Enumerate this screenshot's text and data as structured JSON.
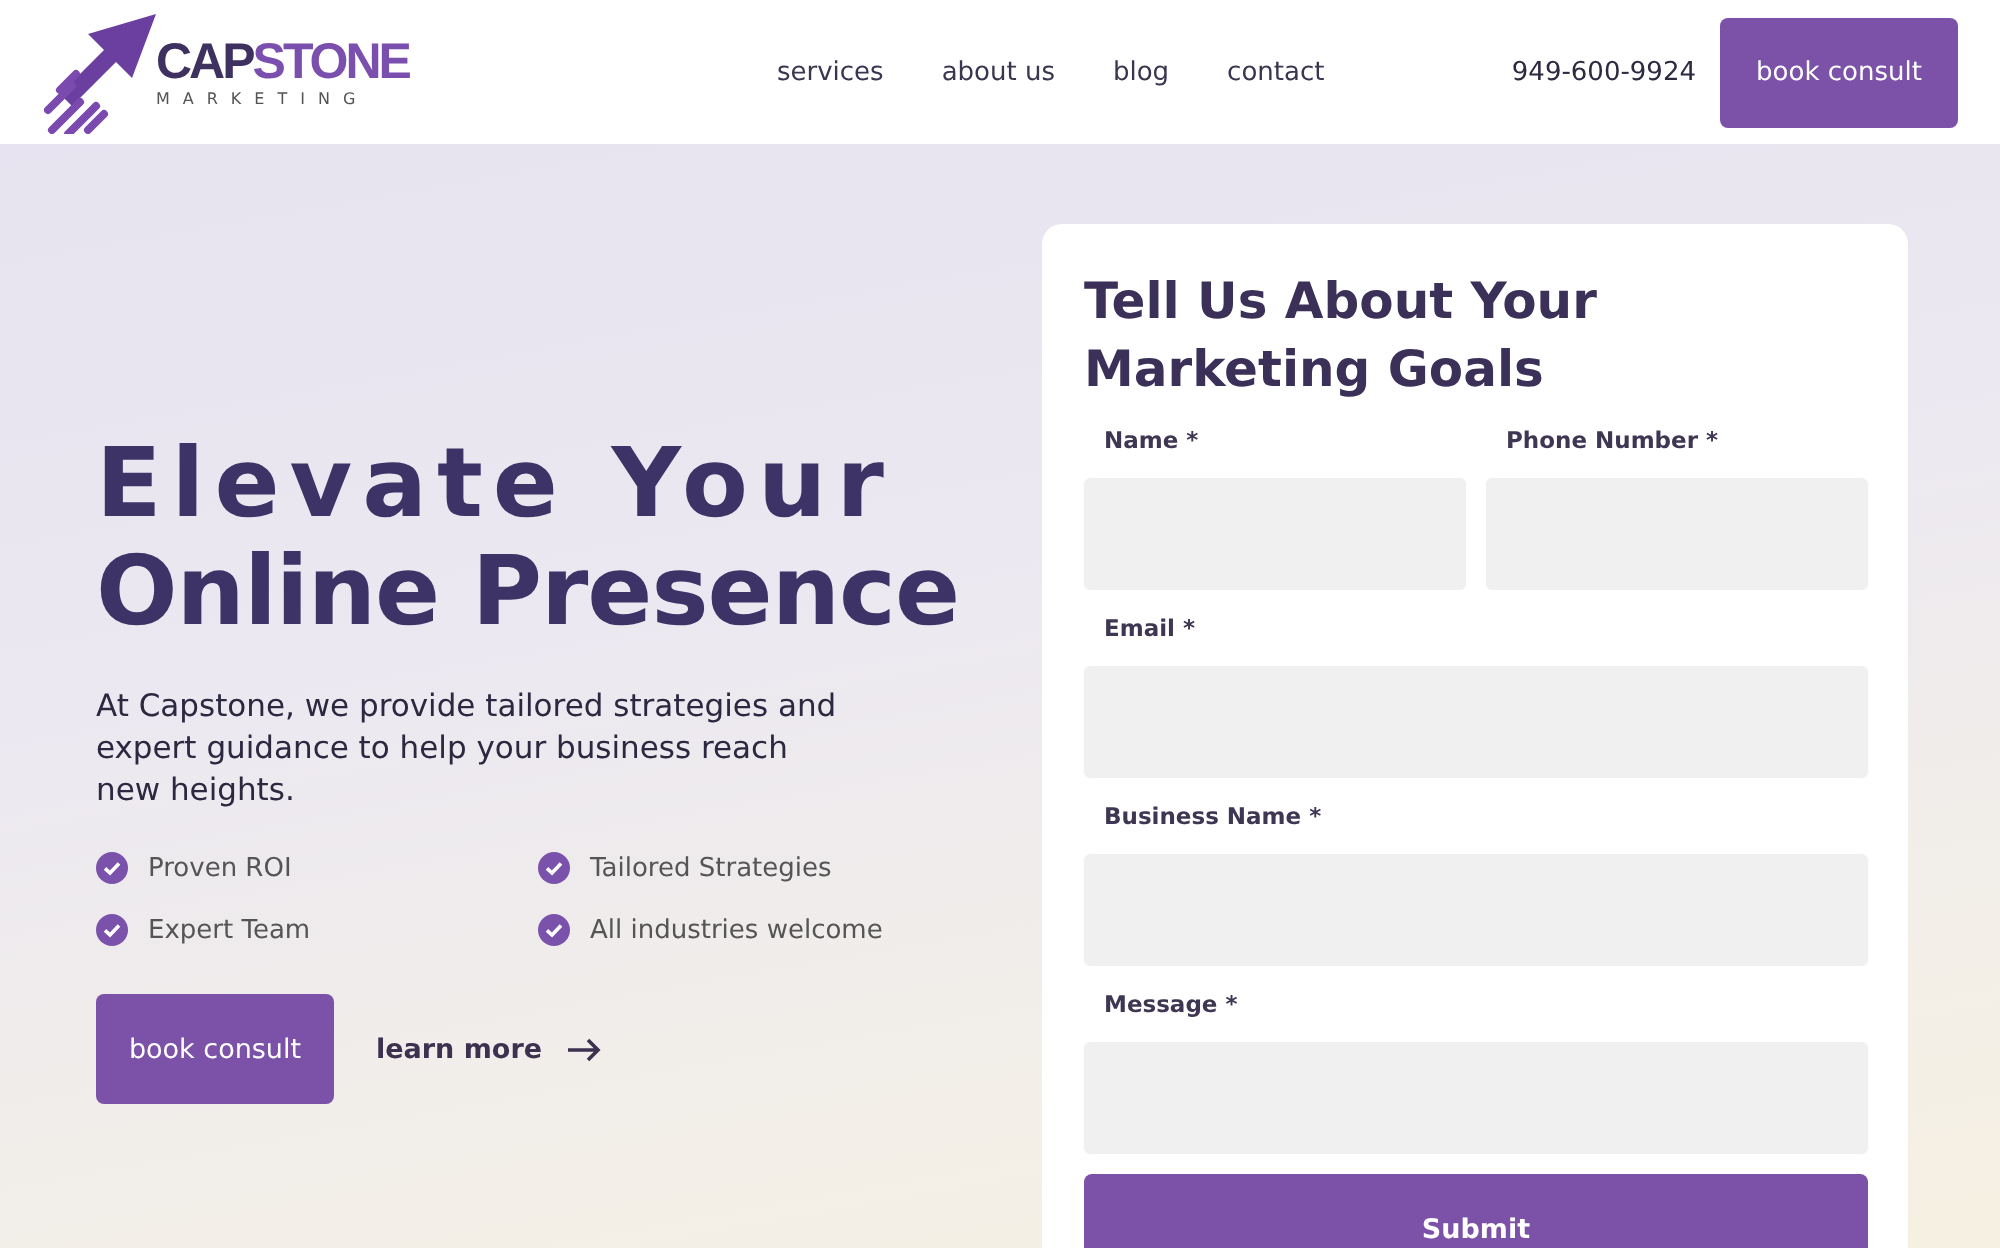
{
  "header": {
    "logo": {
      "part_1": "CAP",
      "part_2": "STONE",
      "tagline": "MARKETING"
    },
    "nav": [
      "services",
      "about us",
      "blog",
      "contact"
    ],
    "phone": "949-600-9924",
    "cta": "book consult"
  },
  "hero": {
    "title_line_1": "Elevate Your",
    "title_line_2": "Online Presence",
    "text": "At Capstone, we provide tailored strategies and expert guidance to help your business reach new heights.",
    "features": [
      "Proven ROI",
      "Tailored Strategies",
      "Expert Team",
      "All industries welcome"
    ],
    "primary_button": "book consult",
    "link": "learn more"
  },
  "form": {
    "title": "Tell Us About Your Marketing Goals",
    "fields": [
      {
        "label": "Name *",
        "kind": "half"
      },
      {
        "label": "Phone Number *",
        "kind": "half"
      },
      {
        "label": "Email *",
        "kind": "full"
      },
      {
        "label": "Business Name *",
        "kind": "full"
      },
      {
        "label": "Message *",
        "kind": "full"
      }
    ],
    "submit": "Submit"
  }
}
